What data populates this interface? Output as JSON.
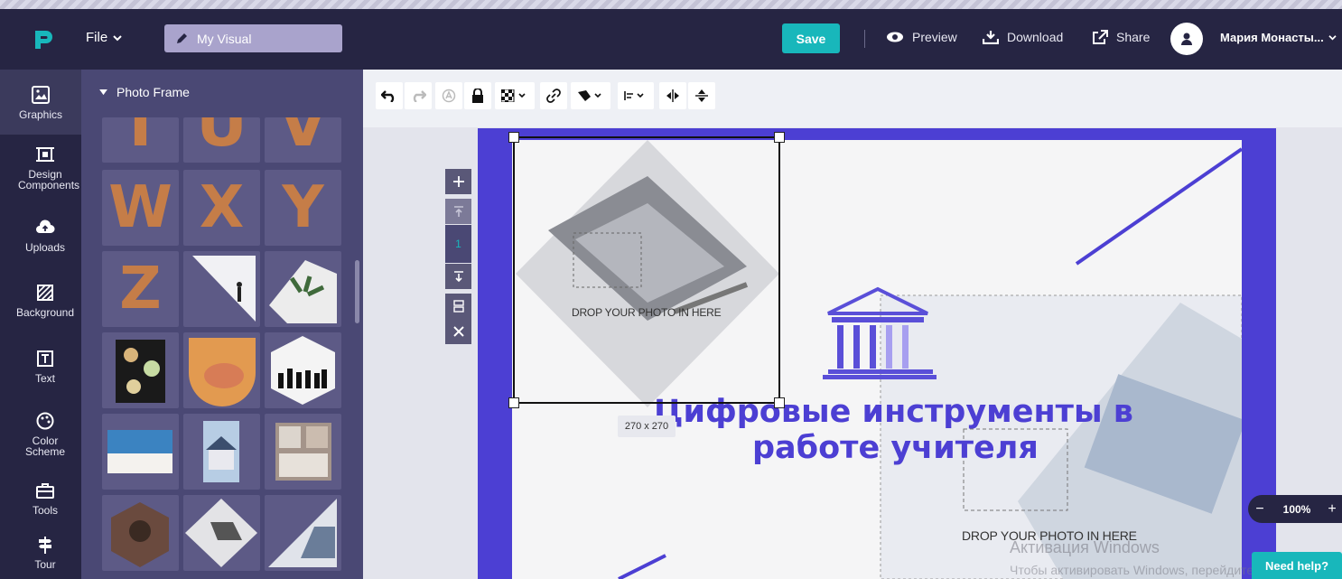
{
  "header": {
    "file_menu": "File",
    "visual_name": "My Visual",
    "save": "Save",
    "preview": "Preview",
    "download": "Download",
    "share": "Share",
    "user_name": "Мария Монасты..."
  },
  "nav": {
    "items": [
      {
        "label": "Graphics",
        "icon": "graphics-icon"
      },
      {
        "label": "Design Components",
        "icon": "components-icon"
      },
      {
        "label": "Uploads",
        "icon": "upload-cloud-icon"
      },
      {
        "label": "Background",
        "icon": "background-icon"
      },
      {
        "label": "Text",
        "icon": "text-icon"
      },
      {
        "label": "Color Scheme",
        "icon": "palette-icon"
      },
      {
        "label": "Tools",
        "icon": "toolbox-icon"
      },
      {
        "label": "Tour",
        "icon": "signpost-icon"
      }
    ]
  },
  "panel": {
    "title": "Photo Frame",
    "letters_row1": [
      "T",
      "U",
      "V"
    ],
    "letters_row2": [
      "W",
      "X",
      "Y"
    ],
    "letter_z": "Z"
  },
  "canvas": {
    "size_label": "270 x 270",
    "drop_text_1": "DROP YOUR PHOTO IN HERE",
    "drop_text_2": "DROP YOUR PHOTO IN HERE",
    "heading_line1": "Цифровые инструменты в",
    "heading_line2": "работе учителя",
    "page_number": "1"
  },
  "zoom": {
    "minus": "−",
    "value": "100%",
    "plus": "+"
  },
  "help": "Need help?",
  "watermark": {
    "line1": "Активация Windows",
    "line2": "Чтобы активировать Windows, перейдите"
  },
  "colors": {
    "accent": "#4c3fd3",
    "teal": "#18b7bb",
    "panel": "#4a4874",
    "topbar": "#262543"
  }
}
